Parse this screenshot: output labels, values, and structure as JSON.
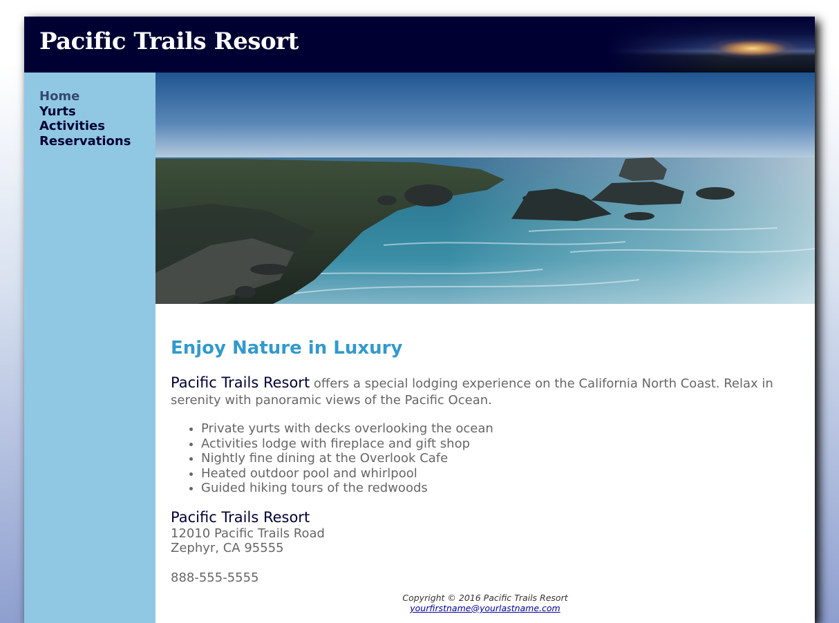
{
  "header": {
    "title": "Pacific Trails Resort"
  },
  "nav": {
    "items": [
      {
        "label": "Home",
        "current": true
      },
      {
        "label": "Yurts"
      },
      {
        "label": "Activities"
      },
      {
        "label": "Reservations"
      }
    ]
  },
  "hero": {
    "image": "coastline-photo"
  },
  "main": {
    "heading": "Enjoy Nature in Luxury",
    "intro_resort": "Pacific Trails Resort",
    "intro_text": " offers a special lodging experience on the California North Coast. Relax in serenity with panoramic views of the Pacific Ocean.",
    "amenities": [
      "Private yurts with decks overlooking the ocean",
      "Activities lodge with fireplace and gift shop",
      "Nightly fine dining at the Overlook Cafe",
      "Heated outdoor pool and whirlpool",
      "Guided hiking tours of the redwoods"
    ],
    "address": {
      "name": "Pacific Trails Resort",
      "street": "12010 Pacific Trails Road",
      "city": "Zephyr, CA 95555"
    },
    "phone": "888-555-5555"
  },
  "footer": {
    "copyright": "Copyright © 2016 Pacific Trails Resort",
    "email": "yourfirstname@yourlastname.com"
  },
  "colors": {
    "header_bg": "#000033",
    "nav_bg": "#90c7e3",
    "heading": "#3399cc",
    "text": "#666666"
  }
}
